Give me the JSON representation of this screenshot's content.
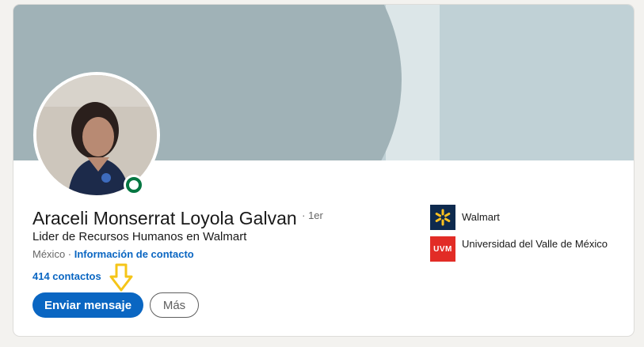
{
  "profile": {
    "name": "Araceli Monserrat Loyola Galvan",
    "degree": "· 1er",
    "headline": "Lider de Recursos Humanos en Walmart",
    "location": "México",
    "separator": " · ",
    "contact_info_label": "Información de contacto",
    "connections_label": "414 contactos"
  },
  "actions": {
    "message_label": "Enviar mensaje",
    "more_label": "Más"
  },
  "organizations": [
    {
      "name": "Walmart",
      "logo_icon": "walmart-spark-icon"
    },
    {
      "name": "Universidad del Valle de México",
      "logo_text": "UVM",
      "logo_icon": "uvm-logo-icon"
    }
  ],
  "colors": {
    "primary": "#0a66c2",
    "online": "#057642",
    "annotation_arrow": "#f5c518",
    "cover_dark": "#a0b2b7",
    "cover_light": "#c0d1d6"
  }
}
